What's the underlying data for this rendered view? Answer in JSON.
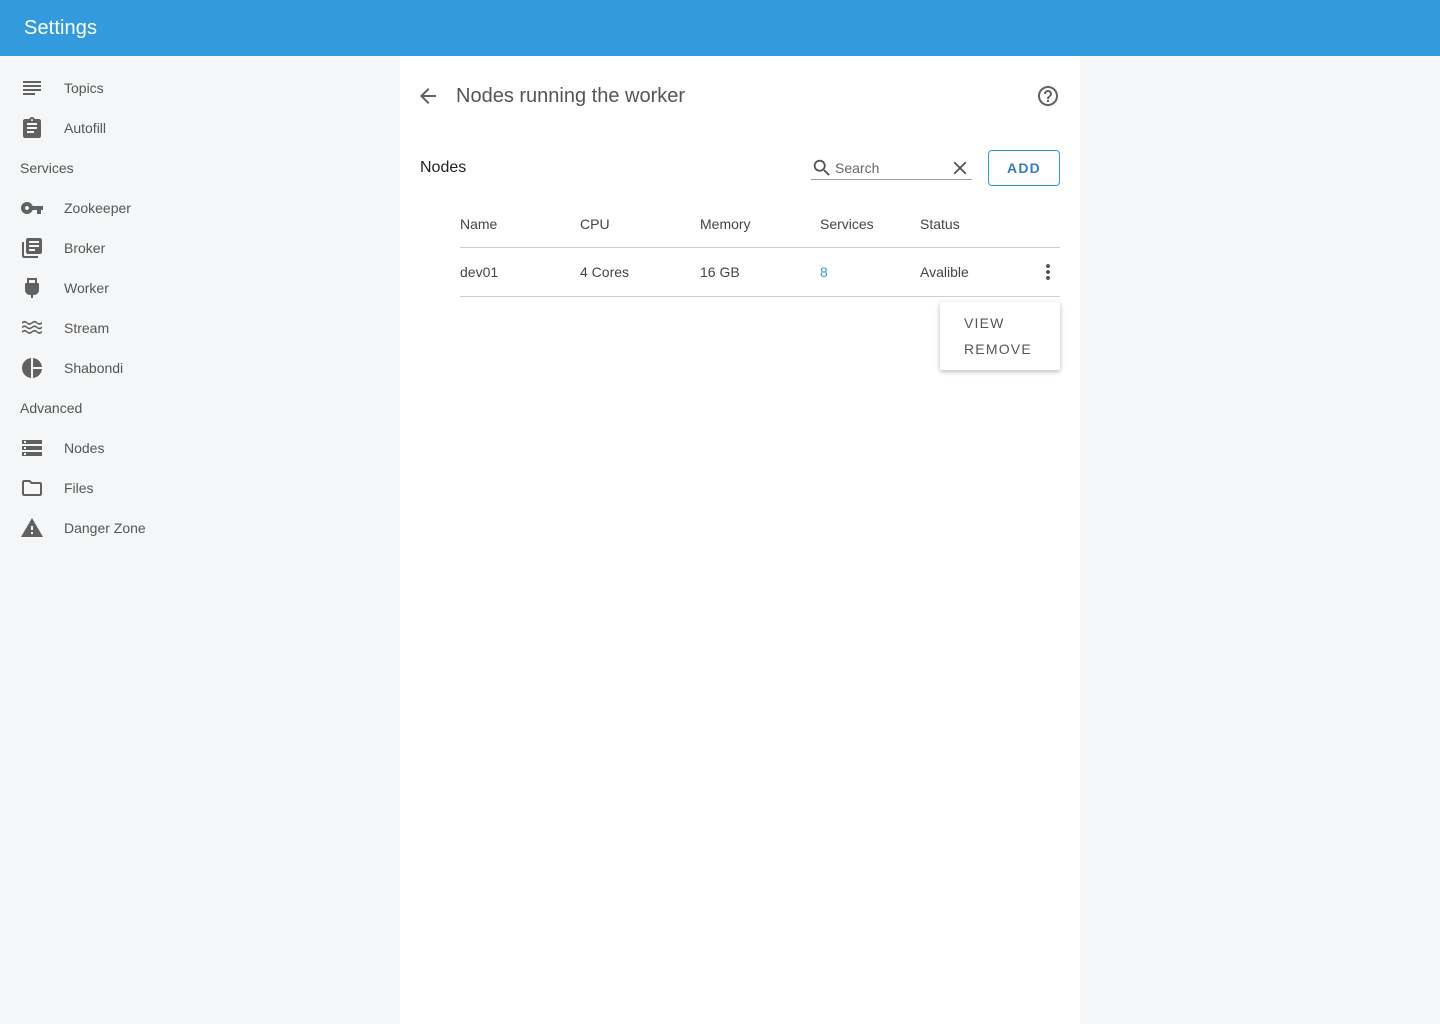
{
  "appbar": {
    "title": "Settings"
  },
  "sidebar": {
    "items": [
      {
        "label": "Topics",
        "icon": "list-icon"
      },
      {
        "label": "Autofill",
        "icon": "clipboard-icon"
      },
      {
        "label": "Zookeeper",
        "icon": "key-icon"
      },
      {
        "label": "Broker",
        "icon": "library-books-icon"
      },
      {
        "label": "Worker",
        "icon": "usb-plug-icon"
      },
      {
        "label": "Stream",
        "icon": "waves-icon"
      },
      {
        "label": "Shabondi",
        "icon": "pie-chart-icon"
      },
      {
        "label": "Nodes",
        "icon": "storage-icon"
      },
      {
        "label": "Files",
        "icon": "folder-icon"
      },
      {
        "label": "Danger Zone",
        "icon": "warning-icon"
      }
    ],
    "subheaders": {
      "services": "Services",
      "advanced": "Advanced"
    }
  },
  "panel": {
    "title": "Nodes running the worker",
    "section_title": "Nodes",
    "search": {
      "placeholder": "Search",
      "value": ""
    },
    "add_label": "ADD",
    "table": {
      "columns": [
        "Name",
        "CPU",
        "Memory",
        "Services",
        "Status"
      ],
      "rows": [
        {
          "name": "dev01",
          "cpu": "4 Cores",
          "memory": "16 GB",
          "services": "8",
          "status": "Avalible"
        }
      ]
    },
    "menu": {
      "view": "VIEW",
      "remove": "REMOVE"
    }
  },
  "colors": {
    "accent": "#339ade",
    "link": "#339ade",
    "sidebar_bg": "#f5f6f7"
  }
}
